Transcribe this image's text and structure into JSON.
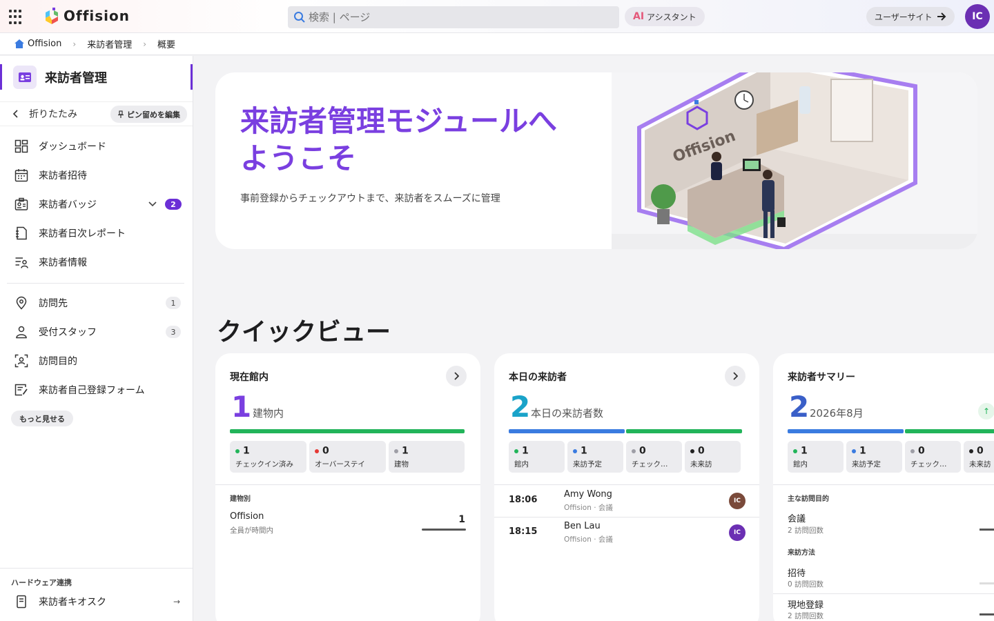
{
  "app": {
    "name": "Offision"
  },
  "search": {
    "placeholder": "検索 | ページ"
  },
  "header": {
    "ai_label": "AI",
    "assistant_label": "アシスタント",
    "user_site_label": "ユーザーサイト",
    "avatar_initials": "IC"
  },
  "breadcrumb": {
    "home": "Offision",
    "level1": "来訪者管理",
    "level2": "概要"
  },
  "sidebar": {
    "module_title": "来訪者管理",
    "collapse_label": "折りたたみ",
    "pin_edit_label": "ピン留めを編集",
    "items": [
      {
        "label": "ダッシュボード",
        "icon": "dashboard-icon"
      },
      {
        "label": "来訪者招待",
        "icon": "calendar-icon"
      },
      {
        "label": "来訪者バッジ",
        "icon": "badge-icon",
        "badge": "2"
      },
      {
        "label": "来訪者日次レポート",
        "icon": "report-icon"
      },
      {
        "label": "来訪者情報",
        "icon": "list-person-icon"
      }
    ],
    "items2": [
      {
        "label": "訪問先",
        "icon": "location-pin-icon",
        "count": "1"
      },
      {
        "label": "受付スタッフ",
        "icon": "person-icon",
        "count": "3"
      },
      {
        "label": "訪問目的",
        "icon": "face-scan-icon"
      },
      {
        "label": "来訪者自己登録フォーム",
        "icon": "form-edit-icon"
      }
    ],
    "more_label": "もっと見せる",
    "hardware_title": "ハードウェア連携",
    "kiosk_label": "来訪者キオスク"
  },
  "hero": {
    "title": "来訪者管理モジュールへようこそ",
    "subtitle": "事前登録からチェックアウトまで、来訪者をスムーズに管理",
    "image_logo_text": "Offision"
  },
  "quick_view": {
    "title": "クイックビュー"
  },
  "cards": {
    "current": {
      "title": "現在館内",
      "big_number": "1",
      "big_label": "建物内",
      "stats": [
        {
          "value": "1",
          "label": "チェックイン済み",
          "color": "#22b45a"
        },
        {
          "value": "0",
          "label": "オーバーステイ",
          "color": "#e53935"
        },
        {
          "value": "1",
          "label": "建物",
          "color": "#9e9ea6"
        }
      ],
      "section_label": "建物別",
      "building_name": "Offision",
      "building_sub": "全員が時間内",
      "building_count": "1"
    },
    "today": {
      "title": "本日の来訪者",
      "big_number": "2",
      "big_label": "本日の来訪者数",
      "stats": [
        {
          "value": "1",
          "label": "館内",
          "color": "#22b45a"
        },
        {
          "value": "1",
          "label": "来訪予定",
          "color": "#3a7be0"
        },
        {
          "value": "0",
          "label": "チェック…",
          "color": "#9e9ea6"
        },
        {
          "value": "0",
          "label": "未来訪",
          "color": "#222222"
        }
      ],
      "visitors": [
        {
          "time": "18:06",
          "name": "Amy Wong",
          "meta": "Offision · 会議",
          "initials": "IC",
          "color": "#7a4a3a"
        },
        {
          "time": "18:15",
          "name": "Ben Lau",
          "meta": "Offision · 会議",
          "initials": "IC",
          "color": "#6b2fb3"
        }
      ]
    },
    "summary": {
      "title": "来訪者サマリー",
      "big_number": "2",
      "big_label": "2026年8月",
      "stats": [
        {
          "value": "1",
          "label": "館内",
          "color": "#22b45a"
        },
        {
          "value": "1",
          "label": "来訪予定",
          "color": "#3a7be0"
        },
        {
          "value": "0",
          "label": "チェック…",
          "color": "#9e9ea6"
        },
        {
          "value": "0",
          "label": "未来訪",
          "color": "#222222"
        }
      ],
      "purpose_label": "主な訪問目的",
      "purpose_name": "会議",
      "purpose_sub": "2 訪問回数",
      "method_label": "来訪方法",
      "methods": [
        {
          "name": "招待",
          "sub": "0 訪問回数"
        },
        {
          "name": "現地登録",
          "sub": "2 訪問回数"
        }
      ]
    }
  },
  "colors": {
    "accent": "#7a3fe0",
    "cyan": "#1aa3c9",
    "blue": "#3a7be0",
    "green": "#22b45a"
  }
}
